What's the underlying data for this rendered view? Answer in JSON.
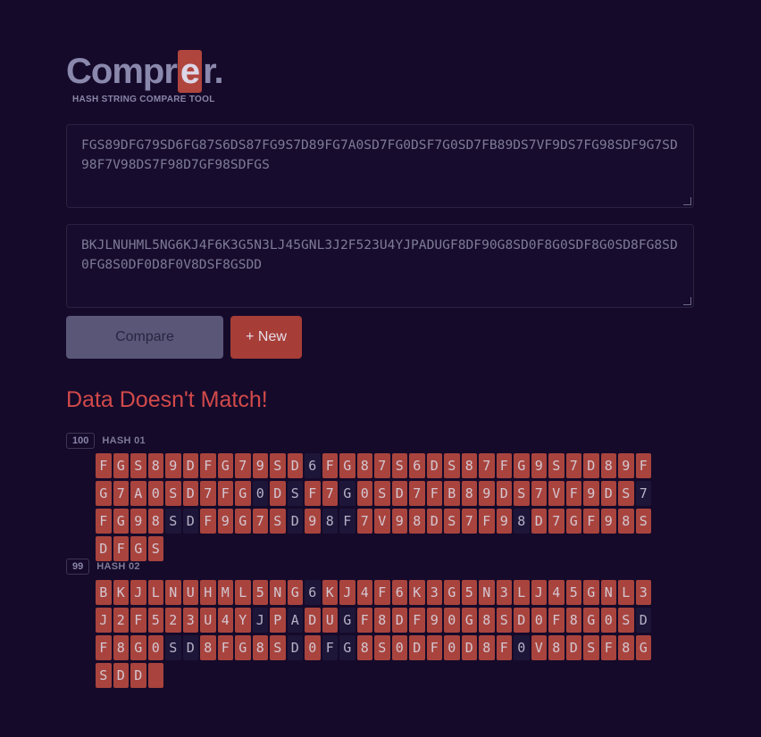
{
  "logo": {
    "before": "Compr",
    "highlight": "e",
    "after": "r.",
    "tagline": "HASH STRING COMPARE TOOL"
  },
  "inputs": {
    "hash1": "FGS89DFG79SD6FG87S6DS87FG9S7D89FG7A0SD7FG0DSF7G0SD7FB89DS7VF9DS7FG98SDF9G7SD98F7V98DS7F98D7GF98SDFGS",
    "hash2": "BKJLNUHML5NG6KJ4F6K3G5N3LJ45GNL3J2F523U4YJPADUGF8DF90G8SD0F8G0SDF8G0SD8FG8SD0FG8S0DF0D8F0V8DSF8GSDD"
  },
  "buttons": {
    "compare": "Compare",
    "new": "+ New"
  },
  "result": {
    "title": "Data Doesn't Match!"
  },
  "hashes": [
    {
      "count": "100",
      "label": "HASH 01",
      "chars": "FGS89DFG79SD6FG87S6DS87FG9S7D89FG7A0SD7FG0DSF7G0SD7FB89DS7VF9DS7FG98SDF9G7SD98F7V98DS7F98D7GF98SDFGS",
      "matches": [
        12,
        41,
        43,
        46,
        63,
        68,
        69,
        75,
        77,
        78,
        88
      ]
    },
    {
      "count": "99",
      "label": "HASH 02",
      "chars": "BKJLNUHML5NG6KJ4F6K3G5N3LJ45GNL3J2F523U4YJPADUGF8DF90G8SD0F8G0SDF8G0SD8FG8SD0FG8S0DF0D8F0V8DSF8GSDD",
      "matches": [
        12,
        41,
        43,
        46,
        63,
        68,
        69,
        75,
        77,
        78,
        88
      ],
      "trailing_blank": true
    }
  ],
  "colors": {
    "background": "#150a2a",
    "mismatch": "#a8443d",
    "match": "#1e1638",
    "alert": "#d24a4a"
  }
}
